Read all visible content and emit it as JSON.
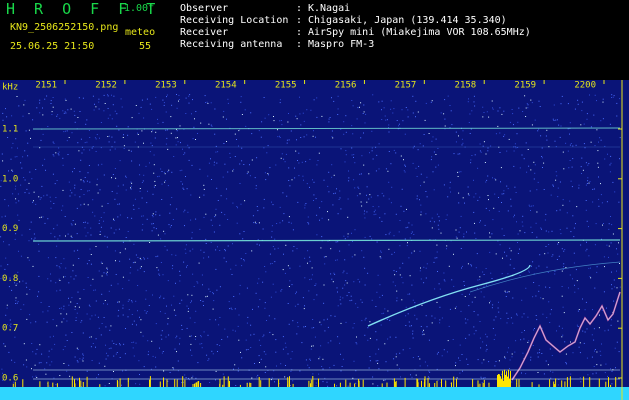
{
  "header": {
    "logo": "H R O F F T",
    "version": "1.00f",
    "filename": "KN9_2506252150.png",
    "datetime": "25.06.25 21:50",
    "mode_label": "meteo",
    "count": "55",
    "meta": [
      {
        "key": "Observer",
        "value": "K.Nagai"
      },
      {
        "key": "Receiving Location",
        "value": "Chigasaki, Japan (139.414 35.340)"
      },
      {
        "key": "Receiver",
        "value": "AirSpy mini (Miakejima VOR 108.65MHz)"
      },
      {
        "key": "Receiving antenna",
        "value": "Maspro FM-3"
      }
    ]
  },
  "spectrogram": {
    "y_unit": "kHz",
    "time_ticks": [
      "2151",
      "2152",
      "2153",
      "2154",
      "2155",
      "2156",
      "2157",
      "2158",
      "2159",
      "2200"
    ],
    "freq_ticks": [
      "1.1",
      "1.0",
      "0.9",
      "0.8",
      "0.7",
      "0.6"
    ],
    "colors": {
      "background": "#0a1478",
      "noise": "#4a6cff",
      "carrier": "#7df0e0",
      "signal": "#ffe600",
      "bottom_band": "#2fd6ff"
    }
  }
}
